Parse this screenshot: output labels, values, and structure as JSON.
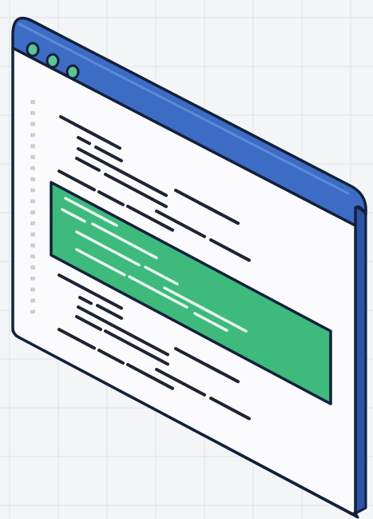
{
  "illustration": {
    "subject": "isometric-code-editor-window",
    "window": {
      "titlebar_buttons": 3,
      "highlighted_block": true
    },
    "colors": {
      "background": "#f4f5f7",
      "grid": "#e1e5ec",
      "frame_outline": "#12203c",
      "titlebar_blue": "#3d6cc4",
      "titlebar_blue_dark": "#2b54a6",
      "titlebar_blue_light": "#5c89d8",
      "window_body": "#fbfbfd",
      "window_shadow_edge": "#d9dde6",
      "code_line": "#1d2433",
      "highlight_green": "#3dba7c",
      "highlight_text": "#e9f8ef",
      "gutter_dot": "#c9ced8",
      "button_fill": "#5cc395"
    }
  }
}
